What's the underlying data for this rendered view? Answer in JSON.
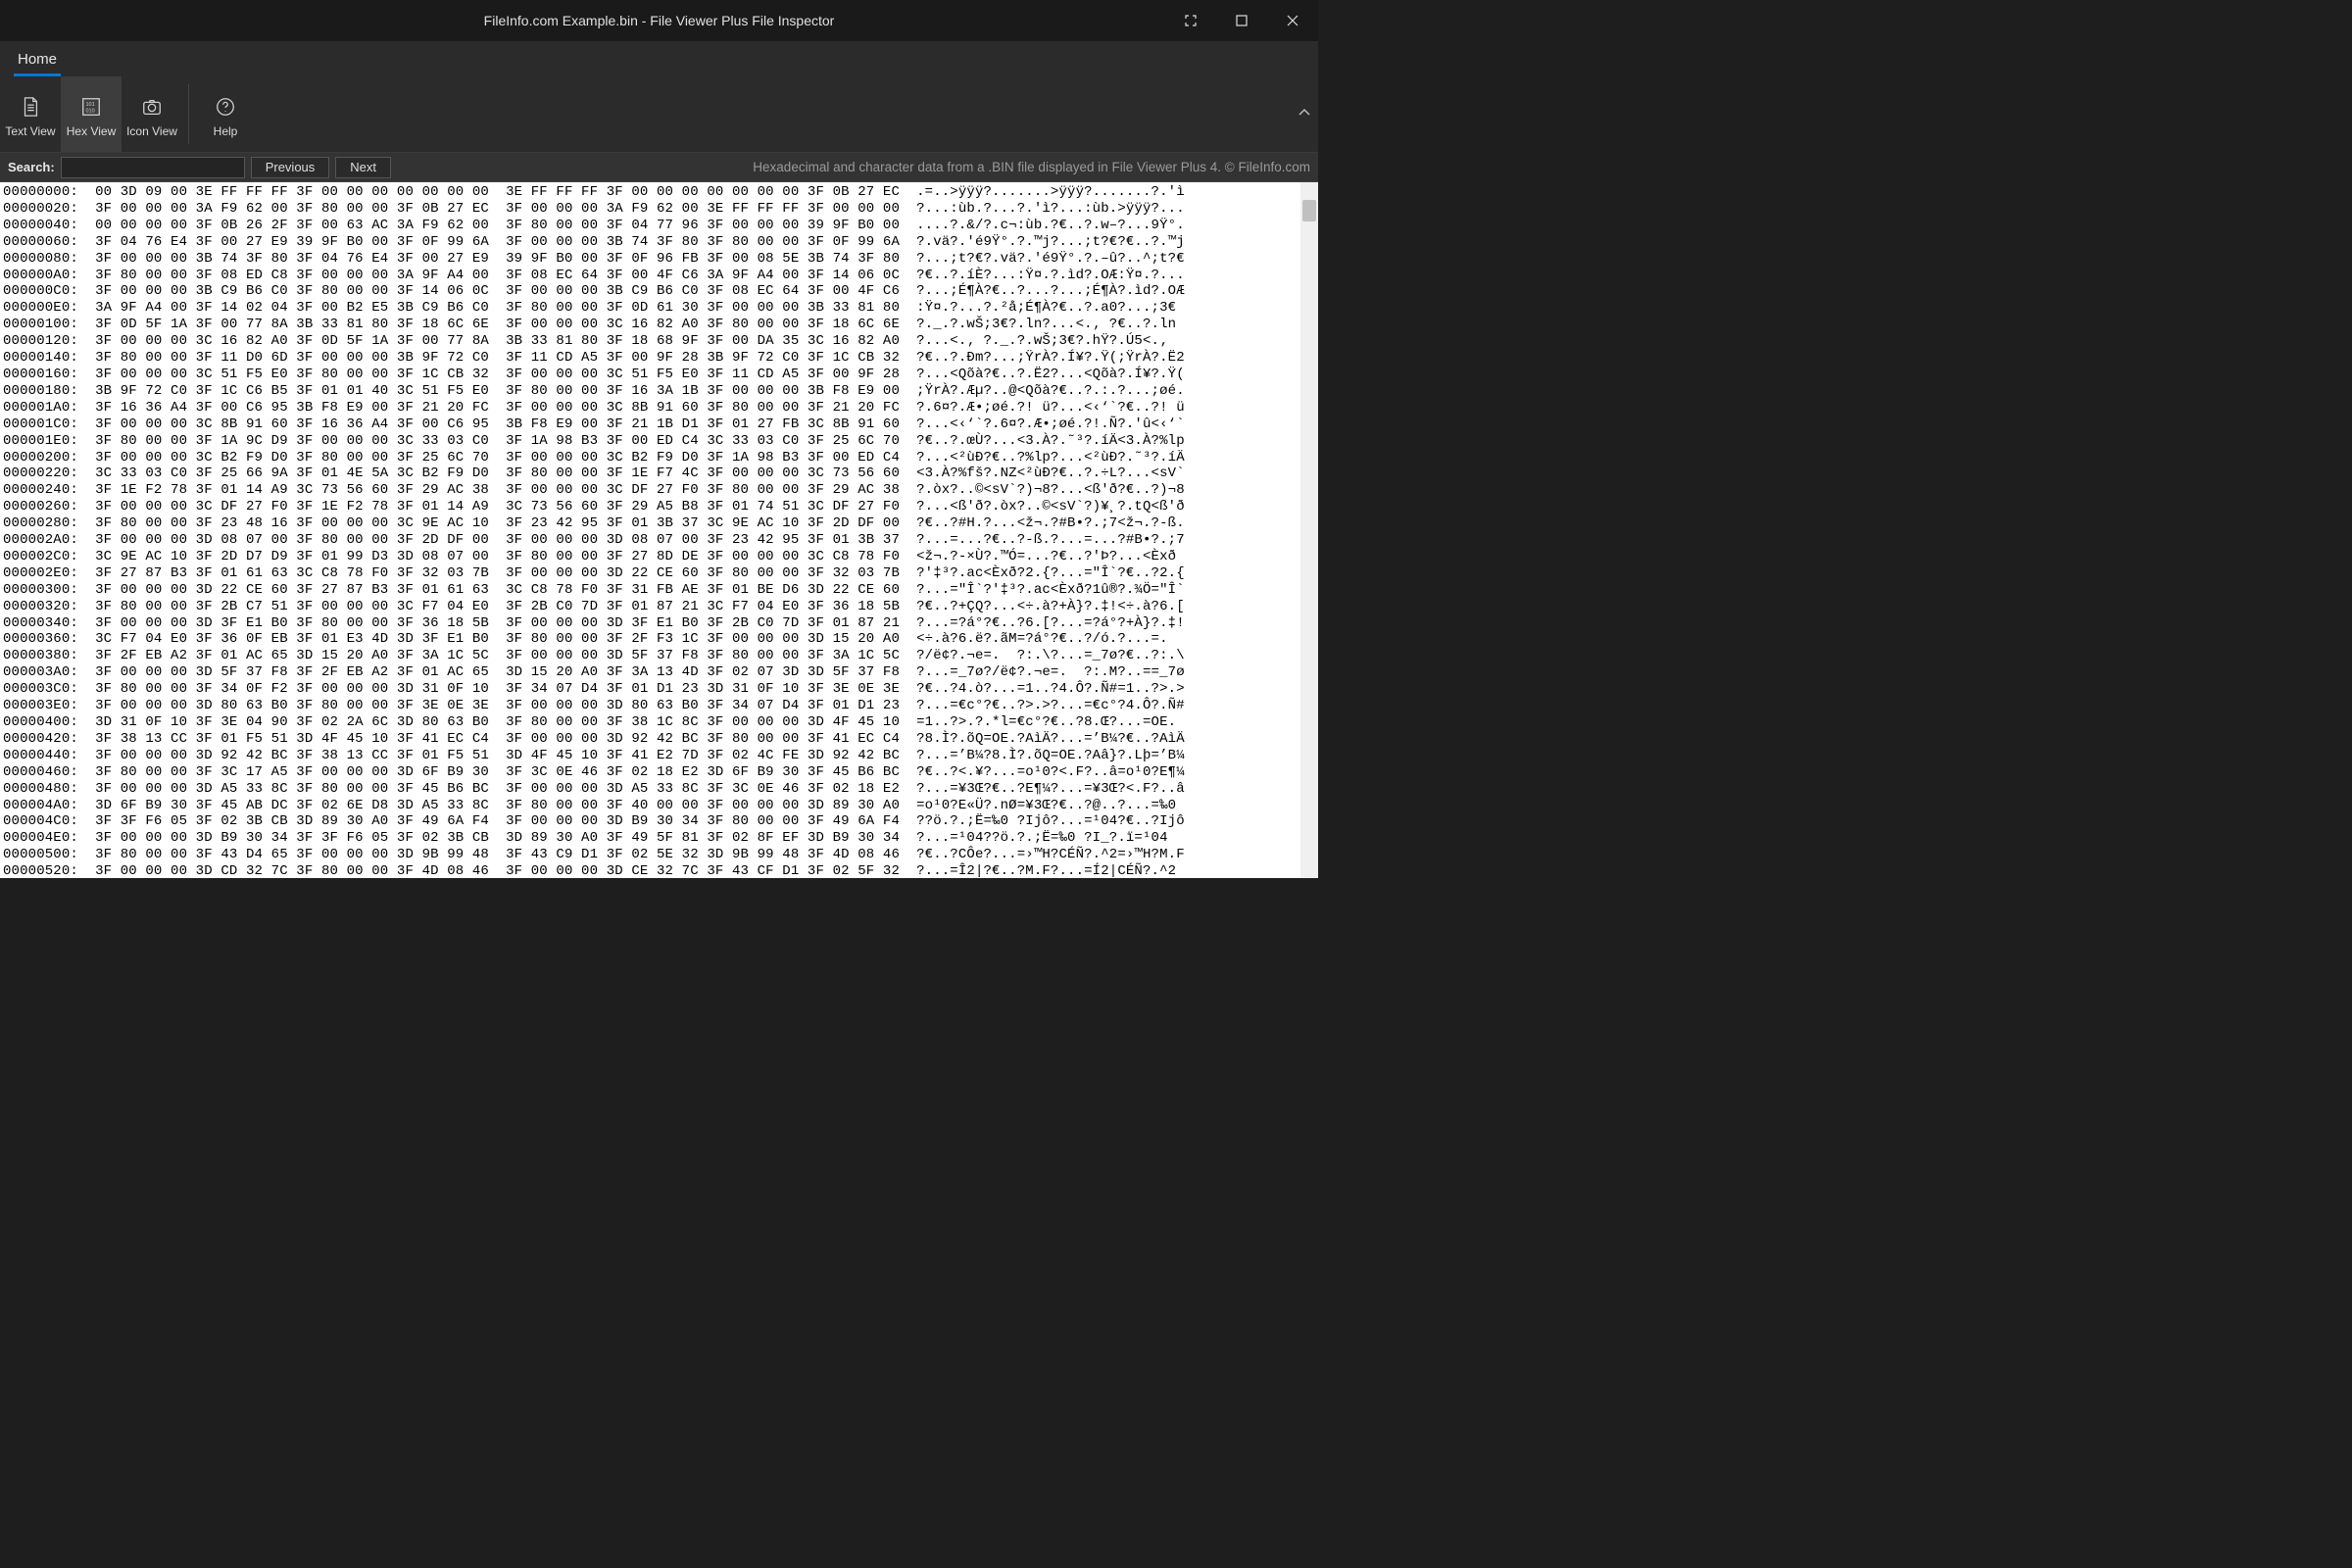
{
  "window": {
    "title": "FileInfo.com Example.bin - File Viewer Plus File Inspector"
  },
  "tabs": {
    "home": "Home"
  },
  "ribbon": {
    "text_view": "Text View",
    "hex_view": "Hex View",
    "icon_view": "Icon View",
    "help": "Help"
  },
  "search": {
    "label": "Search:",
    "value": "",
    "previous": "Previous",
    "next": "Next",
    "hint": "Hexadecimal and character data from a .BIN file displayed in File Viewer Plus 4. © FileInfo.com"
  },
  "hex": {
    "rows": [
      {
        "off": "00000000",
        "h1": "00 3D 09 00 3E FF FF FF 3F 00 00 00 00 00 00 00",
        "h2": "3E FF FF FF 3F 00 00 00 00 00 00 00 3F 0B 27 EC",
        "a": ".=..>ÿÿÿ?.......>ÿÿÿ?.......?.'ì"
      },
      {
        "off": "00000020",
        "h1": "3F 00 00 00 3A F9 62 00 3F 80 00 00 3F 0B 27 EC",
        "h2": "3F 00 00 00 3A F9 62 00 3E FF FF FF 3F 00 00 00",
        "a": "?...:ùb.?...?.'ì?...:ùb.>ÿÿÿ?..."
      },
      {
        "off": "00000040",
        "h1": "00 00 00 00 3F 0B 26 2F 3F 00 63 AC 3A F9 62 00",
        "h2": "3F 80 00 00 3F 04 77 96 3F 00 00 00 39 9F B0 00",
        "a": "....?.&/?.c¬:ùb.?€..?.w–?...9Ÿ°."
      },
      {
        "off": "00000060",
        "h1": "3F 04 76 E4 3F 00 27 E9 39 9F B0 00 3F 0F 99 6A",
        "h2": "3F 00 00 00 3B 74 3F 80 3F 80 00 00 3F 0F 99 6A",
        "a": "?.vä?.'é9Ÿ°.?.™j?...;t?€?€..?.™j"
      },
      {
        "off": "00000080",
        "h1": "3F 00 00 00 3B 74 3F 80 3F 04 76 E4 3F 00 27 E9",
        "h2": "39 9F B0 00 3F 0F 96 FB 3F 00 08 5E 3B 74 3F 80",
        "a": "?...;t?€?.vä?.'é9Ÿ°.?.–û?..^;t?€"
      },
      {
        "off": "000000A0",
        "h1": "3F 80 00 00 3F 08 ED C8 3F 00 00 00 3A 9F A4 00",
        "h2": "3F 08 EC 64 3F 00 4F C6 3A 9F A4 00 3F 14 06 0C",
        "a": "?€..?.íÈ?...:Ÿ¤.?.ìd?.OÆ:Ÿ¤.?..."
      },
      {
        "off": "000000C0",
        "h1": "3F 00 00 00 3B C9 B6 C0 3F 80 00 00 3F 14 06 0C",
        "h2": "3F 00 00 00 3B C9 B6 C0 3F 08 EC 64 3F 00 4F C6",
        "a": "?...;É¶À?€..?...?...;É¶À?.ìd?.OÆ"
      },
      {
        "off": "000000E0",
        "h1": "3A 9F A4 00 3F 14 02 04 3F 00 B2 E5 3B C9 B6 C0",
        "h2": "3F 80 00 00 3F 0D 61 30 3F 00 00 00 3B 33 81 80",
        "a": ":Ÿ¤.?...?.²å;É¶À?€..?.a0?...;3€"
      },
      {
        "off": "00000100",
        "h1": "3F 0D 5F 1A 3F 00 77 8A 3B 33 81 80 3F 18 6C 6E",
        "h2": "3F 00 00 00 3C 16 82 A0 3F 80 00 00 3F 18 6C 6E",
        "a": "?._.?.wŠ;3€?.ln?...<.‚ ?€..?.ln"
      },
      {
        "off": "00000120",
        "h1": "3F 00 00 00 3C 16 82 A0 3F 0D 5F 1A 3F 00 77 8A",
        "h2": "3B 33 81 80 3F 18 68 9F 3F 00 DA 35 3C 16 82 A0",
        "a": "?...<.‚ ?._.?.wŠ;3€?.hŸ?.Ú5<.‚ "
      },
      {
        "off": "00000140",
        "h1": "3F 80 00 00 3F 11 D0 6D 3F 00 00 00 3B 9F 72 C0",
        "h2": "3F 11 CD A5 3F 00 9F 28 3B 9F 72 C0 3F 1C CB 32",
        "a": "?€..?.Ðm?...;ŸrÀ?.Í¥?.Ÿ(;ŸrÀ?.Ë2"
      },
      {
        "off": "00000160",
        "h1": "3F 00 00 00 3C 51 F5 E0 3F 80 00 00 3F 1C CB 32",
        "h2": "3F 00 00 00 3C 51 F5 E0 3F 11 CD A5 3F 00 9F 28",
        "a": "?...<Qõà?€..?.Ë2?...<Qõà?.Í¥?.Ÿ("
      },
      {
        "off": "00000180",
        "h1": "3B 9F 72 C0 3F 1C C6 B5 3F 01 01 40 3C 51 F5 E0",
        "h2": "3F 80 00 00 3F 16 3A 1B 3F 00 00 00 3B F8 E9 00",
        "a": ";ŸrÀ?.Æµ?..@<Qõà?€..?.:.?...;øé."
      },
      {
        "off": "000001A0",
        "h1": "3F 16 36 A4 3F 00 C6 95 3B F8 E9 00 3F 21 20 FC",
        "h2": "3F 00 00 00 3C 8B 91 60 3F 80 00 00 3F 21 20 FC",
        "a": "?.6¤?.Æ•;øé.?! ü?...<‹‘`?€..?! ü"
      },
      {
        "off": "000001C0",
        "h1": "3F 00 00 00 3C 8B 91 60 3F 16 36 A4 3F 00 C6 95",
        "h2": "3B F8 E9 00 3F 21 1B D1 3F 01 27 FB 3C 8B 91 60",
        "a": "?...<‹‘`?.6¤?.Æ•;øé.?!.Ñ?.'û<‹‘`"
      },
      {
        "off": "000001E0",
        "h1": "3F 80 00 00 3F 1A 9C D9 3F 00 00 00 3C 33 03 C0",
        "h2": "3F 1A 98 B3 3F 00 ED C4 3C 33 03 C0 3F 25 6C 70",
        "a": "?€..?.œÙ?...<3.À?.˜³?.íÄ<3.À?%lp"
      },
      {
        "off": "00000200",
        "h1": "3F 00 00 00 3C B2 F9 D0 3F 80 00 00 3F 25 6C 70",
        "h2": "3F 00 00 00 3C B2 F9 D0 3F 1A 98 B3 3F 00 ED C4",
        "a": "?...<²ùÐ?€..?%lp?...<²ùÐ?.˜³?.íÄ"
      },
      {
        "off": "00000220",
        "h1": "3C 33 03 C0 3F 25 66 9A 3F 01 4E 5A 3C B2 F9 D0",
        "h2": "3F 80 00 00 3F 1E F7 4C 3F 00 00 00 3C 73 56 60",
        "a": "<3.À?%fš?.NZ<²ùÐ?€..?.÷L?...<sV`"
      },
      {
        "off": "00000240",
        "h1": "3F 1E F2 78 3F 01 14 A9 3C 73 56 60 3F 29 AC 38",
        "h2": "3F 00 00 00 3C DF 27 F0 3F 80 00 00 3F 29 AC 38",
        "a": "?.òx?..©<sV`?)¬8?...<ß'ð?€..?)¬8"
      },
      {
        "off": "00000260",
        "h1": "3F 00 00 00 3C DF 27 F0 3F 1E F2 78 3F 01 14 A9",
        "h2": "3C 73 56 60 3F 29 A5 B8 3F 01 74 51 3C DF 27 F0",
        "a": "?...<ß'ð?.òx?..©<sV`?)¥¸?.tQ<ß'ð"
      },
      {
        "off": "00000280",
        "h1": "3F 80 00 00 3F 23 48 16 3F 00 00 00 3C 9E AC 10",
        "h2": "3F 23 42 95 3F 01 3B 37 3C 9E AC 10 3F 2D DF 00",
        "a": "?€..?#H.?...<ž¬.?#B•?.;7<ž¬.?-ß."
      },
      {
        "off": "000002A0",
        "h1": "3F 00 00 00 3D 08 07 00 3F 80 00 00 3F 2D DF 00",
        "h2": "3F 00 00 00 3D 08 07 00 3F 23 42 95 3F 01 3B 37",
        "a": "?...=...?€..?-ß.?...=...?#B•?.;7"
      },
      {
        "off": "000002C0",
        "h1": "3C 9E AC 10 3F 2D D7 D9 3F 01 99 D3 3D 08 07 00",
        "h2": "3F 80 00 00 3F 27 8D DE 3F 00 00 00 3C C8 78 F0",
        "a": "<ž¬.?-×Ù?.™Ó=...?€..?'Þ?...<Èxð"
      },
      {
        "off": "000002E0",
        "h1": "3F 27 87 B3 3F 01 61 63 3C C8 78 F0 3F 32 03 7B",
        "h2": "3F 00 00 00 3D 22 CE 60 3F 80 00 00 3F 32 03 7B",
        "a": "?'‡³?.ac<Èxð?2.{?...=\"Î`?€..?2.{"
      },
      {
        "off": "00000300",
        "h1": "3F 00 00 00 3D 22 CE 60 3F 27 87 B3 3F 01 61 63",
        "h2": "3C C8 78 F0 3F 31 FB AE 3F 01 BE D6 3D 22 CE 60",
        "a": "?...=\"Î`?'‡³?.ac<Èxð?1û®?.¾Ö=\"Î`"
      },
      {
        "off": "00000320",
        "h1": "3F 80 00 00 3F 2B C7 51 3F 00 00 00 3C F7 04 E0",
        "h2": "3F 2B C0 7D 3F 01 87 21 3C F7 04 E0 3F 36 18 5B",
        "a": "?€..?+ÇQ?...<÷.à?+À}?.‡!<÷.à?6.["
      },
      {
        "off": "00000340",
        "h1": "3F 00 00 00 3D 3F E1 B0 3F 80 00 00 3F 36 18 5B",
        "h2": "3F 00 00 00 3D 3F E1 B0 3F 2B C0 7D 3F 01 87 21",
        "a": "?...=?á°?€..?6.[?...=?á°?+À}?.‡!"
      },
      {
        "off": "00000360",
        "h1": "3C F7 04 E0 3F 36 0F EB 3F 01 E3 4D 3D 3F E1 B0",
        "h2": "3F 80 00 00 3F 2F F3 1C 3F 00 00 00 3D 15 20 A0",
        "a": "<÷.à?6.ë?.ãM=?á°?€..?/ó.?...=.  "
      },
      {
        "off": "00000380",
        "h1": "3F 2F EB A2 3F 01 AC 65 3D 15 20 A0 3F 3A 1C 5C",
        "h2": "3F 00 00 00 3D 5F 37 F8 3F 80 00 00 3F 3A 1C 5C",
        "a": "?/ë¢?.¬e=.  ?:.\\?...=_7ø?€..?:.\\"
      },
      {
        "off": "000003A0",
        "h1": "3F 00 00 00 3D 5F 37 F8 3F 2F EB A2 3F 01 AC 65",
        "h2": "3D 15 20 A0 3F 3A 13 4D 3F 02 07 3D 3D 5F 37 F8",
        "a": "?...=_7ø?/ë¢?.¬e=.  ?:.M?..==_7ø"
      },
      {
        "off": "000003C0",
        "h1": "3F 80 00 00 3F 34 0F F2 3F 00 00 00 3D 31 0F 10",
        "h2": "3F 34 07 D4 3F 01 D1 23 3D 31 0F 10 3F 3E 0E 3E",
        "a": "?€..?4.ò?...=1..?4.Ô?.Ñ#=1..?>.>"
      },
      {
        "off": "000003E0",
        "h1": "3F 00 00 00 3D 80 63 B0 3F 80 00 00 3F 3E 0E 3E",
        "h2": "3F 00 00 00 3D 80 63 B0 3F 34 07 D4 3F 01 D1 23",
        "a": "?...=€c°?€..?>.>?...=€c°?4.Ô?.Ñ#"
      },
      {
        "off": "00000400",
        "h1": "3D 31 0F 10 3F 3E 04 90 3F 02 2A 6C 3D 80 63 B0",
        "h2": "3F 80 00 00 3F 38 1C 8C 3F 00 00 00 3D 4F 45 10",
        "a": "=1..?>.?.*l=€c°?€..?8.Œ?...=OE."
      },
      {
        "off": "00000420",
        "h1": "3F 38 13 CC 3F 01 F5 51 3D 4F 45 10 3F 41 EC C4",
        "h2": "3F 00 00 00 3D 92 42 BC 3F 80 00 00 3F 41 EC C4",
        "a": "?8.Ì?.õQ=OE.?AìÄ?...=’B¼?€..?AìÄ"
      },
      {
        "off": "00000440",
        "h1": "3F 00 00 00 3D 92 42 BC 3F 38 13 CC 3F 01 F5 51",
        "h2": "3D 4F 45 10 3F 41 E2 7D 3F 02 4C FE 3D 92 42 BC",
        "a": "?...=’B¼?8.Ì?.õQ=OE.?Aâ}?.Lþ=’B¼"
      },
      {
        "off": "00000460",
        "h1": "3F 80 00 00 3F 3C 17 A5 3F 00 00 00 3D 6F B9 30",
        "h2": "3F 3C 0E 46 3F 02 18 E2 3D 6F B9 30 3F 45 B6 BC",
        "a": "?€..?<.¥?...=o¹0?<.F?..â=o¹0?E¶¼"
      },
      {
        "off": "00000480",
        "h1": "3F 00 00 00 3D A5 33 8C 3F 80 00 00 3F 45 B6 BC",
        "h2": "3F 00 00 00 3D A5 33 8C 3F 3C 0E 46 3F 02 18 E2",
        "a": "?...=¥3Œ?€..?E¶¼?...=¥3Œ?<.F?..â"
      },
      {
        "off": "000004A0",
        "h1": "3D 6F B9 30 3F 45 AB DC 3F 02 6E D8 3D A5 33 8C",
        "h2": "3F 80 00 00 3F 40 00 00 3F 00 00 00 3D 89 30 A0",
        "a": "=o¹0?E«Ü?.nØ=¥3Œ?€..?@..?...=‰0 "
      },
      {
        "off": "000004C0",
        "h1": "3F 3F F6 05 3F 02 3B CB 3D 89 30 A0 3F 49 6A F4",
        "h2": "3F 00 00 00 3D B9 30 34 3F 80 00 00 3F 49 6A F4",
        "a": "??ö.?.;Ë=‰0 ?Ijô?...=¹04?€..?Ijô"
      },
      {
        "off": "000004E0",
        "h1": "3F 00 00 00 3D B9 30 34 3F 3F F6 05 3F 02 3B CB",
        "h2": "3D 89 30 A0 3F 49 5F 81 3F 02 8F EF 3D B9 30 34",
        "a": "?...=¹04??ö.?.;Ë=‰0 ?I_?.ï=¹04"
      },
      {
        "off": "00000500",
        "h1": "3F 80 00 00 3F 43 D4 65 3F 00 00 00 3D 9B 99 48",
        "h2": "3F 43 C9 D1 3F 02 5E 32 3D 9B 99 48 3F 4D 08 46",
        "a": "?€..?CÔe?...=›™H?CÉÑ?.^2=›™H?M.F"
      },
      {
        "off": "00000520",
        "h1": "3F 00 00 00 3D CD 32 7C 3F 80 00 00 3F 4D 08 46",
        "h2": "3F 00 00 00 3D CE 32 7C 3F 43 CF D1 3F 02 5F 32",
        "a": "?...=Î2|?€..?M.F?...=Í2|CÉÑ?.^2"
      }
    ]
  }
}
